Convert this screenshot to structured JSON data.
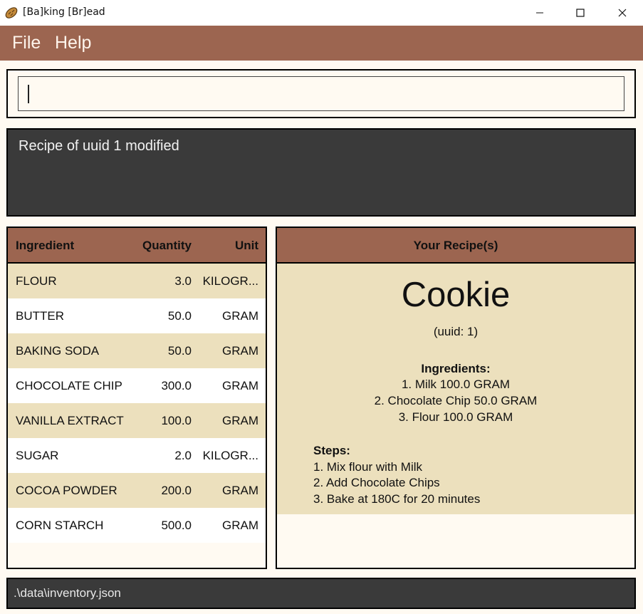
{
  "window": {
    "title": "[Ba]king [Br]ead",
    "icon": "bread-icon"
  },
  "menu": {
    "items": [
      {
        "label": "File"
      },
      {
        "label": "Help"
      }
    ]
  },
  "command": {
    "value": ""
  },
  "result": {
    "message": "Recipe of uuid 1 modified"
  },
  "inventory": {
    "headers": {
      "ingredient": "Ingredient",
      "quantity": "Quantity",
      "unit": "Unit"
    },
    "rows": [
      {
        "name": "FLOUR",
        "quantity": "3.0",
        "unit": "KILOGR..."
      },
      {
        "name": "BUTTER",
        "quantity": "50.0",
        "unit": "GRAM"
      },
      {
        "name": "BAKING SODA",
        "quantity": "50.0",
        "unit": "GRAM"
      },
      {
        "name": "CHOCOLATE CHIP",
        "quantity": "300.0",
        "unit": "GRAM"
      },
      {
        "name": "VANILLA EXTRACT",
        "quantity": "100.0",
        "unit": "GRAM"
      },
      {
        "name": "SUGAR",
        "quantity": "2.0",
        "unit": "KILOGR..."
      },
      {
        "name": "COCOA POWDER",
        "quantity": "200.0",
        "unit": "GRAM"
      },
      {
        "name": "CORN STARCH",
        "quantity": "500.0",
        "unit": "GRAM"
      }
    ]
  },
  "recipes": {
    "header": "Your Recipe(s)",
    "current": {
      "name": "Cookie",
      "uuid": "(uuid: 1)",
      "ingredients_heading": "Ingredients:",
      "ingredients": [
        "1. Milk 100.0 GRAM",
        "2. Chocolate Chip 50.0 GRAM",
        "3. Flour 100.0 GRAM"
      ],
      "steps_heading": "Steps:",
      "steps": [
        "1. Mix flour with Milk",
        "2. Add Chocolate Chips",
        "3. Bake at 180C for 20 minutes"
      ]
    }
  },
  "status": {
    "path": ".\\data\\inventory.json"
  },
  "colors": {
    "accent": "#9c6550",
    "row_alt": "#ece0bd",
    "dark_panel": "#3a3a3a",
    "background": "#fffaf2"
  }
}
